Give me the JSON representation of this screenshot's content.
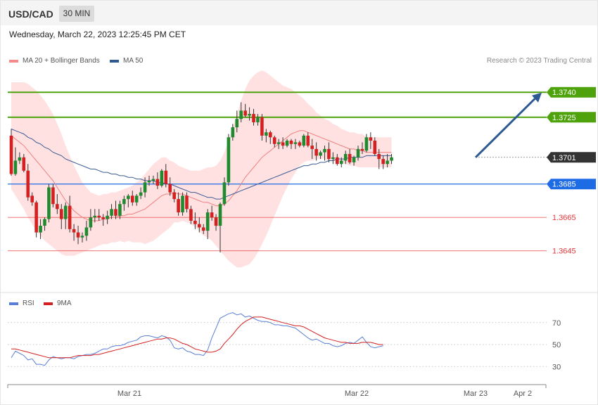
{
  "header": {
    "symbol": "USD/CAD",
    "timeframe": "30 MIN"
  },
  "datetime": "Wednesday, March 22, 2023 12:25:45 PM CET",
  "legend": {
    "ma20_bb": {
      "label": "MA 20 + Bollinger Bands",
      "color": "#f48a8a"
    },
    "ma50": {
      "label": "MA 50",
      "color": "#2e5a94"
    }
  },
  "credit": "Research © 2023 Trading Central",
  "rsi_legend": {
    "rsi": {
      "label": "RSI",
      "color": "#5b7fd6"
    },
    "ma9": {
      "label": "9MA",
      "color": "#d42020"
    }
  },
  "chart_data": [
    {
      "type": "candlestick",
      "instrument": "USD/CAD",
      "interval": "30 MIN",
      "ylim": [
        1.362,
        1.377
      ],
      "price_lines": [
        {
          "label": "1.3740",
          "value": 1.374,
          "color": "#4ea20b",
          "style": "box"
        },
        {
          "label": "1.3725",
          "value": 1.3725,
          "color": "#4ea20b",
          "style": "box"
        },
        {
          "label": "1.3701",
          "value": 1.3701,
          "color": "#333333",
          "style": "box"
        },
        {
          "label": "1.3685",
          "value": 1.3685,
          "color": "#1e6be6",
          "style": "box"
        },
        {
          "label": "1.3665",
          "value": 1.3665,
          "color": "#e8383a",
          "style": "text"
        },
        {
          "label": "1.3645",
          "value": 1.3645,
          "color": "#e8383a",
          "style": "text"
        }
      ],
      "x_ticks": [
        "Mar 21",
        "Mar 22",
        "Mar 23",
        "Apr 2"
      ],
      "candles": [
        [
          1.3714,
          1.3718,
          1.369,
          1.3691
        ],
        [
          1.3691,
          1.3707,
          1.369,
          1.3699
        ],
        [
          1.3699,
          1.3704,
          1.3697,
          1.3701
        ],
        [
          1.3701,
          1.3703,
          1.3692,
          1.3693
        ],
        [
          1.3693,
          1.3697,
          1.3675,
          1.3677
        ],
        [
          1.3678,
          1.368,
          1.3672,
          1.3674
        ],
        [
          1.3674,
          1.3675,
          1.3653,
          1.3656
        ],
        [
          1.3656,
          1.3664,
          1.3652,
          1.366
        ],
        [
          1.366,
          1.3665,
          1.3657,
          1.3664
        ],
        [
          1.3664,
          1.3685,
          1.3662,
          1.3683
        ],
        [
          1.3683,
          1.3685,
          1.3671,
          1.3673
        ],
        [
          1.3673,
          1.3679,
          1.3667,
          1.367
        ],
        [
          1.367,
          1.3673,
          1.3658,
          1.3664
        ],
        [
          1.3664,
          1.3674,
          1.3658,
          1.3672
        ],
        [
          1.3672,
          1.3678,
          1.3656,
          1.3658
        ],
        [
          1.3658,
          1.3661,
          1.3651,
          1.3656
        ],
        [
          1.3656,
          1.366,
          1.3649,
          1.3653
        ],
        [
          1.3653,
          1.3656,
          1.365,
          1.3654
        ],
        [
          1.3654,
          1.3663,
          1.3651,
          1.3659
        ],
        [
          1.3659,
          1.367,
          1.3657,
          1.3665
        ],
        [
          1.3665,
          1.367,
          1.3662,
          1.3666
        ],
        [
          1.3666,
          1.367,
          1.3663,
          1.3665
        ],
        [
          1.3665,
          1.3667,
          1.366,
          1.3664
        ],
        [
          1.3664,
          1.3669,
          1.3661,
          1.3666
        ],
        [
          1.3666,
          1.3673,
          1.3664,
          1.367
        ],
        [
          1.367,
          1.3675,
          1.3664,
          1.3666
        ],
        [
          1.3666,
          1.3675,
          1.3664,
          1.3673
        ],
        [
          1.3673,
          1.3678,
          1.3669,
          1.3676
        ],
        [
          1.3676,
          1.3679,
          1.3671,
          1.3678
        ],
        [
          1.3678,
          1.3681,
          1.3672,
          1.3674
        ],
        [
          1.3674,
          1.3679,
          1.3672,
          1.3678
        ],
        [
          1.3678,
          1.3683,
          1.3676,
          1.368
        ],
        [
          1.368,
          1.3689,
          1.3677,
          1.3686
        ],
        [
          1.3686,
          1.369,
          1.3684,
          1.3687
        ],
        [
          1.3687,
          1.369,
          1.3685,
          1.3688
        ],
        [
          1.3688,
          1.3692,
          1.3682,
          1.3684
        ],
        [
          1.3684,
          1.3694,
          1.3683,
          1.3693
        ],
        [
          1.3693,
          1.3697,
          1.3683,
          1.3685
        ],
        [
          1.3685,
          1.3689,
          1.3678,
          1.368
        ],
        [
          1.368,
          1.3682,
          1.3674,
          1.3676
        ],
        [
          1.3676,
          1.368,
          1.3666,
          1.3668
        ],
        [
          1.3668,
          1.368,
          1.3666,
          1.3678
        ],
        [
          1.3678,
          1.368,
          1.3668,
          1.367
        ],
        [
          1.367,
          1.3672,
          1.3661,
          1.3663
        ],
        [
          1.3663,
          1.3668,
          1.3658,
          1.3661
        ],
        [
          1.3661,
          1.3665,
          1.3656,
          1.3659
        ],
        [
          1.3659,
          1.3661,
          1.3655,
          1.3657
        ],
        [
          1.3657,
          1.367,
          1.3652,
          1.3668
        ],
        [
          1.3668,
          1.3672,
          1.3663,
          1.3665
        ],
        [
          1.3665,
          1.3667,
          1.3657,
          1.366
        ],
        [
          1.366,
          1.3674,
          1.3644,
          1.3673
        ],
        [
          1.3673,
          1.3689,
          1.3672,
          1.3686
        ],
        [
          1.3686,
          1.3715,
          1.3684,
          1.3713
        ],
        [
          1.3713,
          1.3721,
          1.3711,
          1.3719
        ],
        [
          1.3719,
          1.3729,
          1.3716,
          1.3724
        ],
        [
          1.3724,
          1.3734,
          1.3722,
          1.3729
        ],
        [
          1.3729,
          1.3733,
          1.3725,
          1.3726
        ],
        [
          1.3726,
          1.3731,
          1.3723,
          1.3727
        ],
        [
          1.3727,
          1.373,
          1.372,
          1.3722
        ],
        [
          1.3722,
          1.3727,
          1.372,
          1.3725
        ],
        [
          1.3725,
          1.3727,
          1.3711,
          1.3714
        ],
        [
          1.3714,
          1.3718,
          1.371,
          1.3716
        ],
        [
          1.3716,
          1.3717,
          1.3709,
          1.3713
        ],
        [
          1.3713,
          1.3714,
          1.3707,
          1.3709
        ],
        [
          1.3709,
          1.3712,
          1.3706,
          1.371
        ],
        [
          1.371,
          1.3713,
          1.3706,
          1.3708
        ],
        [
          1.3708,
          1.3712,
          1.3707,
          1.3711
        ],
        [
          1.3711,
          1.3712,
          1.3706,
          1.3709
        ],
        [
          1.3709,
          1.3712,
          1.3706,
          1.371
        ],
        [
          1.371,
          1.3711,
          1.3707,
          1.3708
        ],
        [
          1.3708,
          1.3715,
          1.3707,
          1.3714
        ],
        [
          1.3714,
          1.3716,
          1.3707,
          1.3708
        ],
        [
          1.3708,
          1.3712,
          1.37,
          1.3706
        ],
        [
          1.3706,
          1.371,
          1.3699,
          1.3702
        ],
        [
          1.3702,
          1.3705,
          1.37,
          1.3704
        ],
        [
          1.3704,
          1.3708,
          1.3699,
          1.3706
        ],
        [
          1.3706,
          1.371,
          1.3698,
          1.37
        ],
        [
          1.37,
          1.3704,
          1.3697,
          1.3701
        ],
        [
          1.3701,
          1.3703,
          1.3696,
          1.3697
        ],
        [
          1.3697,
          1.3701,
          1.3695,
          1.3699
        ],
        [
          1.3699,
          1.3705,
          1.3697,
          1.3703
        ],
        [
          1.3703,
          1.3706,
          1.3697,
          1.3698
        ],
        [
          1.3698,
          1.3702,
          1.3696,
          1.3701
        ],
        [
          1.3701,
          1.3708,
          1.3699,
          1.3706
        ],
        [
          1.3706,
          1.371,
          1.3703,
          1.3705
        ],
        [
          1.3705,
          1.3715,
          1.3704,
          1.3713
        ],
        [
          1.3713,
          1.3716,
          1.3706,
          1.3711
        ],
        [
          1.3711,
          1.3713,
          1.3702,
          1.3703
        ],
        [
          1.3703,
          1.3706,
          1.3694,
          1.37
        ],
        [
          1.37,
          1.3702,
          1.3694,
          1.3697
        ],
        [
          1.3697,
          1.3703,
          1.3695,
          1.3699
        ],
        [
          1.3699,
          1.3703,
          1.3697,
          1.3701
        ]
      ],
      "ma20": [
        1.3714,
        1.3712,
        1.371,
        1.3708,
        1.3705,
        1.3702,
        1.3699,
        1.3696,
        1.3693,
        1.369,
        1.3687,
        1.3683,
        1.3679,
        1.3675,
        1.3672,
        1.3669,
        1.3667,
        1.3665,
        1.3664,
        1.3663,
        1.3663,
        1.3663,
        1.3664,
        1.3664,
        1.3665,
        1.3665,
        1.3666,
        1.3666,
        1.3667,
        1.3667,
        1.3668,
        1.3669,
        1.367,
        1.3672,
        1.3674,
        1.3676,
        1.3678,
        1.3679,
        1.3679,
        1.368,
        1.3679,
        1.3679,
        1.3678,
        1.3677,
        1.3676,
        1.3675,
        1.3674,
        1.3674,
        1.3673,
        1.3672,
        1.3672,
        1.3673,
        1.3675,
        1.3678,
        1.3681,
        1.3685,
        1.3689,
        1.3692,
        1.3695,
        1.3698,
        1.3701,
        1.3703,
        1.3705,
        1.3707,
        1.3709,
        1.3711,
        1.3713,
        1.3715,
        1.3716,
        1.3717,
        1.3717,
        1.3716,
        1.3715,
        1.3714,
        1.3713,
        1.3712,
        1.3711,
        1.371,
        1.3709,
        1.3708,
        1.3707,
        1.3706,
        1.3706,
        1.3705,
        1.3705,
        1.3704,
        1.3704,
        1.3704,
        1.3704,
        1.3704,
        1.3704,
        1.3704
      ],
      "ma50": [
        1.3718,
        1.3717,
        1.3716,
        1.3715,
        1.3713,
        1.3712,
        1.371,
        1.3709,
        1.3707,
        1.3706,
        1.3704,
        1.3703,
        1.3702,
        1.37,
        1.3699,
        1.3698,
        1.3697,
        1.3696,
        1.3695,
        1.3694,
        1.3694,
        1.3693,
        1.3692,
        1.3692,
        1.3691,
        1.3691,
        1.369,
        1.369,
        1.3689,
        1.3689,
        1.3688,
        1.3688,
        1.3687,
        1.3687,
        1.3687,
        1.3686,
        1.3686,
        1.3685,
        1.3685,
        1.3684,
        1.3683,
        1.3682,
        1.3681,
        1.368,
        1.368,
        1.3679,
        1.3678,
        1.3677,
        1.3677,
        1.3676,
        1.3676,
        1.3677,
        1.3678,
        1.3679,
        1.368,
        1.3681,
        1.3682,
        1.3683,
        1.3684,
        1.3685,
        1.3686,
        1.3687,
        1.3688,
        1.3689,
        1.369,
        1.3691,
        1.3692,
        1.3693,
        1.3694,
        1.3695,
        1.3696,
        1.3696,
        1.3697,
        1.3697,
        1.3698,
        1.3698,
        1.3699,
        1.3699,
        1.37,
        1.37,
        1.37,
        1.3701,
        1.3701,
        1.3701,
        1.3701,
        1.3702,
        1.3702,
        1.3702,
        1.3702,
        1.3702,
        1.3702,
        1.3702
      ],
      "bb_width": [
        0.0032,
        0.0034,
        0.0036,
        0.0038,
        0.004,
        0.0041,
        0.0042,
        0.0042,
        0.0042,
        0.0041,
        0.004,
        0.0038,
        0.0036,
        0.0033,
        0.003,
        0.0027,
        0.0024,
        0.0021,
        0.0019,
        0.0017,
        0.0016,
        0.0015,
        0.0015,
        0.0015,
        0.0015,
        0.0015,
        0.0015,
        0.0016,
        0.0016,
        0.0017,
        0.0018,
        0.0019,
        0.0021,
        0.0022,
        0.0023,
        0.0023,
        0.0023,
        0.0022,
        0.002,
        0.0018,
        0.0017,
        0.0016,
        0.0016,
        0.0016,
        0.0017,
        0.0018,
        0.002,
        0.0021,
        0.0022,
        0.0024,
        0.0027,
        0.0031,
        0.0036,
        0.0041,
        0.0046,
        0.005,
        0.0053,
        0.0055,
        0.0055,
        0.0054,
        0.0052,
        0.0049,
        0.0045,
        0.0041,
        0.0037,
        0.0033,
        0.003,
        0.0027,
        0.0024,
        0.0021,
        0.0019,
        0.0017,
        0.0016,
        0.0014,
        0.0013,
        0.0012,
        0.0012,
        0.0011,
        0.0011,
        0.001,
        0.001,
        0.001,
        0.001,
        0.001,
        0.001,
        0.0009,
        0.0009,
        0.0009,
        0.0009,
        0.0009,
        0.0009,
        0.0009
      ],
      "forecast_arrow": {
        "from": 1.3701,
        "to": 1.374
      }
    },
    {
      "type": "line",
      "title": "RSI",
      "ylim": [
        18,
        82
      ],
      "y_ticks": [
        70,
        50,
        30
      ],
      "series": [
        {
          "name": "RSI",
          "color": "#5b7fd6",
          "values": [
            38,
            44,
            42,
            40,
            36,
            37,
            32,
            32,
            31,
            36,
            39,
            38,
            37,
            38,
            38,
            37,
            39,
            40,
            41,
            41,
            42,
            44,
            46,
            46,
            48,
            49,
            49,
            50,
            52,
            53,
            54,
            57,
            58,
            58,
            57,
            56,
            58,
            57,
            54,
            47,
            46,
            47,
            44,
            43,
            41,
            41,
            40,
            45,
            56,
            65,
            74,
            76,
            78,
            79,
            77,
            78,
            75,
            76,
            74,
            72,
            71,
            71,
            70,
            68,
            68,
            67,
            67,
            66,
            65,
            62,
            59,
            56,
            54,
            55,
            53,
            51,
            51,
            49,
            48,
            49,
            51,
            52,
            51,
            54,
            57,
            52,
            48,
            47,
            48,
            49
          ]
        },
        {
          "name": "9MA",
          "color": "#d42020",
          "values": [
            46,
            46,
            45,
            44,
            43,
            42,
            41,
            40,
            39,
            38,
            38,
            38,
            38,
            38,
            38,
            39,
            40,
            40,
            40,
            40,
            41,
            41,
            42,
            43,
            44,
            45,
            46,
            47,
            48,
            49,
            50,
            51,
            52,
            53,
            54,
            55,
            55,
            56,
            56,
            55,
            53,
            51,
            50,
            48,
            46,
            45,
            44,
            43,
            43,
            44,
            46,
            51,
            55,
            59,
            64,
            68,
            71,
            73,
            75,
            75,
            75,
            74,
            73,
            72,
            71,
            70,
            69,
            68,
            67,
            67,
            66,
            64,
            62,
            60,
            58,
            56,
            55,
            54,
            53,
            52,
            52,
            51,
            51,
            51,
            52,
            52,
            52,
            51,
            50,
            50
          ]
        }
      ]
    }
  ]
}
